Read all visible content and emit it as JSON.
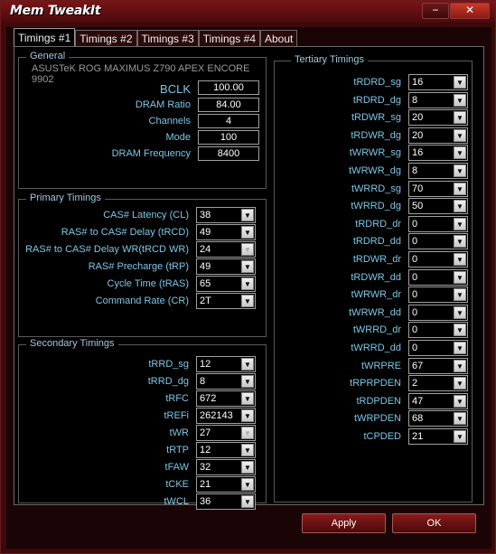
{
  "window": {
    "title": "Mem TweakIt",
    "minimize_glyph": "−",
    "close_glyph": "✕"
  },
  "tabs": [
    "Timings #1",
    "Timings #2",
    "Timings #3",
    "Timings #4",
    "About"
  ],
  "general": {
    "legend": "General",
    "board": "ASUSTeK ROG MAXIMUS Z790 APEX ENCORE 9902",
    "fields": [
      {
        "label": "BCLK",
        "value": "100.00"
      },
      {
        "label": "DRAM Ratio",
        "value": "84.00"
      },
      {
        "label": "Channels",
        "value": "4"
      },
      {
        "label": "Mode",
        "value": "100"
      },
      {
        "label": "DRAM Frequency",
        "value": "8400"
      }
    ]
  },
  "primary": {
    "legend": "Primary Timings",
    "rows": [
      {
        "label": "CAS# Latency (CL)",
        "value": "38",
        "disabled": false
      },
      {
        "label": "RAS# to CAS# Delay (tRCD)",
        "value": "49",
        "disabled": false
      },
      {
        "label": "RAS# to CAS# Delay WR(tRCD WR)",
        "value": "24",
        "disabled": true
      },
      {
        "label": "RAS# Precharge (tRP)",
        "value": "49",
        "disabled": false
      },
      {
        "label": "Cycle Time (tRAS)",
        "value": "65",
        "disabled": false
      },
      {
        "label": "Command Rate (CR)",
        "value": "2T",
        "disabled": false
      }
    ]
  },
  "secondary": {
    "legend": "Secondary Timings",
    "rows": [
      {
        "label": "tRRD_sg",
        "value": "12",
        "disabled": false
      },
      {
        "label": "tRRD_dg",
        "value": "8",
        "disabled": false
      },
      {
        "label": "tRFC",
        "value": "672",
        "disabled": false
      },
      {
        "label": "tREFi",
        "value": "262143",
        "disabled": false
      },
      {
        "label": "tWR",
        "value": "27",
        "disabled": true
      },
      {
        "label": "tRTP",
        "value": "12",
        "disabled": false
      },
      {
        "label": "tFAW",
        "value": "32",
        "disabled": false
      },
      {
        "label": "tCKE",
        "value": "21",
        "disabled": false
      },
      {
        "label": "tWCL",
        "value": "36",
        "disabled": false
      }
    ]
  },
  "tertiary": {
    "legend": "Tertiary Timings",
    "rows": [
      {
        "label": "tRDRD_sg",
        "value": "16"
      },
      {
        "label": "tRDRD_dg",
        "value": "8"
      },
      {
        "label": "tRDWR_sg",
        "value": "20"
      },
      {
        "label": "tRDWR_dg",
        "value": "20"
      },
      {
        "label": "tWRWR_sg",
        "value": "16"
      },
      {
        "label": "tWRWR_dg",
        "value": "8"
      },
      {
        "label": "tWRRD_sg",
        "value": "70"
      },
      {
        "label": "tWRRD_dg",
        "value": "50"
      },
      {
        "label": "tRDRD_dr",
        "value": "0"
      },
      {
        "label": "tRDRD_dd",
        "value": "0"
      },
      {
        "label": "tRDWR_dr",
        "value": "0"
      },
      {
        "label": "tRDWR_dd",
        "value": "0"
      },
      {
        "label": "tWRWR_dr",
        "value": "0"
      },
      {
        "label": "tWRWR_dd",
        "value": "0"
      },
      {
        "label": "tWRRD_dr",
        "value": "0"
      },
      {
        "label": "tWRRD_dd",
        "value": "0"
      },
      {
        "label": "tWRPRE",
        "value": "67"
      },
      {
        "label": "tRPRPDEN",
        "value": "2"
      },
      {
        "label": "tRDPDEN",
        "value": "47"
      },
      {
        "label": "tWRPDEN",
        "value": "68"
      },
      {
        "label": "tCPDED",
        "value": "21"
      }
    ]
  },
  "footer": {
    "apply": "Apply",
    "ok": "OK"
  },
  "colors": {
    "accent": "#7cc7e6",
    "frame": "#3a0a0c",
    "titlebar": "#7a1418"
  }
}
